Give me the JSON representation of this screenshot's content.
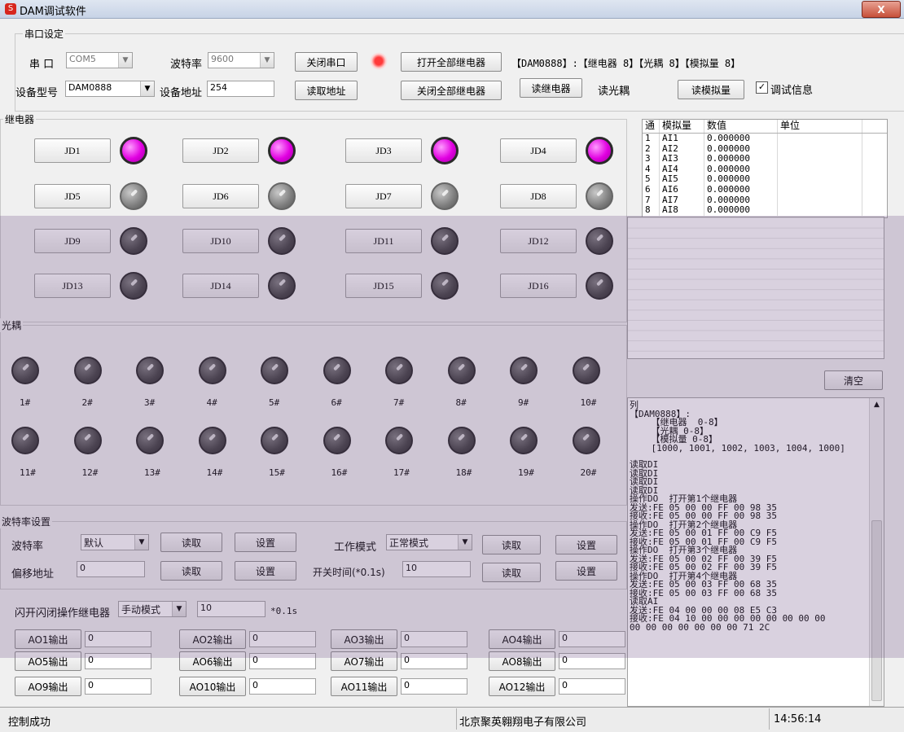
{
  "window": {
    "title": "DAM调试软件",
    "close_glyph": "X"
  },
  "serial": {
    "group_title": "串口设定",
    "port_label": "串 口",
    "port_value": "COM5",
    "baud_label": "波特率",
    "baud_value": "9600",
    "close_port": "关闭串口",
    "open_all": "打开全部继电器",
    "close_all": "关闭全部继电器",
    "summary": "【DAM0888】:【继电器 8】【光耦 8】【模拟量 8】",
    "model_label": "设备型号",
    "model_value": "DAM0888",
    "addr_label": "设备地址",
    "addr_value": "254",
    "read_addr": "读取地址",
    "read_relay": "读继电器",
    "read_opto": "读光耦",
    "read_analog": "读模拟量",
    "debug_label": "调试信息",
    "debug_checked": true
  },
  "relay": {
    "group_title": "继电器",
    "items": [
      {
        "label": "JD1",
        "state": "on"
      },
      {
        "label": "JD2",
        "state": "on"
      },
      {
        "label": "JD3",
        "state": "on"
      },
      {
        "label": "JD4",
        "state": "on"
      },
      {
        "label": "JD5",
        "state": "off"
      },
      {
        "label": "JD6",
        "state": "off"
      },
      {
        "label": "JD7",
        "state": "off"
      },
      {
        "label": "JD8",
        "state": "off"
      },
      {
        "label": "JD9",
        "state": "dark"
      },
      {
        "label": "JD10",
        "state": "dark"
      },
      {
        "label": "JD11",
        "state": "dark"
      },
      {
        "label": "JD12",
        "state": "dark"
      },
      {
        "label": "JD13",
        "state": "dark"
      },
      {
        "label": "JD14",
        "state": "dark"
      },
      {
        "label": "JD15",
        "state": "dark"
      },
      {
        "label": "JD16",
        "state": "dark"
      }
    ]
  },
  "analog_table": {
    "headers": [
      "通",
      "模拟量",
      "数值",
      "单位"
    ],
    "rows": [
      [
        "1",
        "AI1",
        "0.000000",
        ""
      ],
      [
        "2",
        "AI2",
        "0.000000",
        ""
      ],
      [
        "3",
        "AI3",
        "0.000000",
        ""
      ],
      [
        "4",
        "AI4",
        "0.000000",
        ""
      ],
      [
        "5",
        "AI5",
        "0.000000",
        ""
      ],
      [
        "6",
        "AI6",
        "0.000000",
        ""
      ],
      [
        "7",
        "AI7",
        "0.000000",
        ""
      ],
      [
        "8",
        "AI8",
        "0.000000",
        ""
      ]
    ]
  },
  "clear_button": "清空",
  "opto": {
    "group_title": "光耦",
    "labels": [
      "1#",
      "2#",
      "3#",
      "4#",
      "5#",
      "6#",
      "7#",
      "8#",
      "9#",
      "10#",
      "11#",
      "12#",
      "13#",
      "14#",
      "15#",
      "16#",
      "17#",
      "18#",
      "19#",
      "20#"
    ]
  },
  "baud_settings": {
    "group_title": "波特率设置",
    "baud_label": "波特率",
    "baud_value": "默认",
    "read": "读取",
    "set": "设置",
    "mode_label": "工作模式",
    "mode_value": "正常模式",
    "offset_label": "偏移地址",
    "offset_value": "0",
    "switch_time_label": "开关时间(*0.1s)",
    "switch_time_value": "10",
    "flash_label": "闪开闪闭操作继电器",
    "flash_mode": "手动模式",
    "flash_value": "10",
    "flash_unit": "*0.1s"
  },
  "ao_outputs": [
    {
      "label": "AO1输出",
      "value": "0"
    },
    {
      "label": "AO2输出",
      "value": "0"
    },
    {
      "label": "AO3输出",
      "value": "0"
    },
    {
      "label": "AO4输出",
      "value": "0"
    },
    {
      "label": "AO5输出",
      "value": "0"
    },
    {
      "label": "AO6输出",
      "value": "0"
    },
    {
      "label": "AO7输出",
      "value": "0"
    },
    {
      "label": "AO8输出",
      "value": "0"
    },
    {
      "label": "AO9输出",
      "value": "0"
    },
    {
      "label": "AO10输出",
      "value": "0"
    },
    {
      "label": "AO11输出",
      "value": "0"
    },
    {
      "label": "AO12输出",
      "value": "0"
    }
  ],
  "log_lines": [
    "列",
    "【DAM0888】:",
    "    【继电器  0-8】",
    "    【光耦 0-8】",
    "    【模拟量 0-8】",
    "    [1000, 1001, 1002, 1003, 1004, 1000]",
    "",
    "读取DI",
    "读取DI",
    "读取DI",
    "读取DI",
    "操作DO  打开第1个继电器",
    "发送:FE 05 00 00 FF 00 98 35",
    "接收:FE 05 00 00 FF 00 98 35",
    "操作DO  打开第2个继电器",
    "发送:FE 05 00 01 FF 00 C9 F5",
    "接收:FE 05 00 01 FF 00 C9 F5",
    "操作DO  打开第3个继电器",
    "发送:FE 05 00 02 FF 00 39 F5",
    "接收:FE 05 00 02 FF 00 39 F5",
    "操作DO  打开第4个继电器",
    "发送:FE 05 00 03 FF 00 68 35",
    "接收:FE 05 00 03 FF 00 68 35",
    "读取AI",
    "发送:FE 04 00 00 00 08 E5 C3",
    "接收:FE 04 10 00 00 00 00 00 00 00 00",
    "00 00 00 00 00 00 00 71 2C"
  ],
  "status": {
    "left": "控制成功",
    "company": "北京聚英翱翔电子有限公司",
    "time": "14:56:14"
  }
}
